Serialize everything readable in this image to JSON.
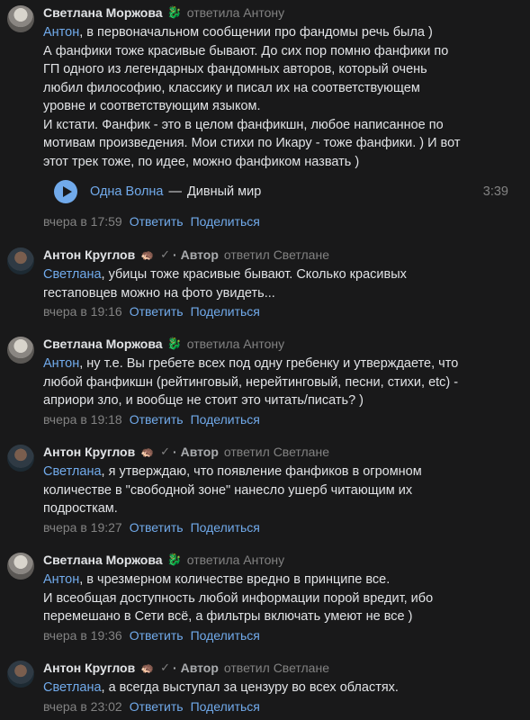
{
  "comments": [
    {
      "author": "Светлана Моржова",
      "badge_icon": "dragon-emoji-icon",
      "replied": "ответила Антону",
      "mention": "Антон",
      "lines": [
        ", в первоначальном сообщении про фандомы речь была )",
        "А фанфики тоже красивые бывают. До сих пор помню фанфики по",
        "ГП одного из легендарных фандомных авторов, который очень",
        "любил философию, классику и писал их на соответствующем",
        "уровне и соответствующим языком.",
        "И кстати. Фанфик - это в целом фанфикшн, любое написанное по",
        "мотивам произведения. Мои стихи по Икару - тоже фанфики. ) И вот",
        "этот трек тоже, по идее, можно фанфиком назвать )"
      ],
      "audio": {
        "artist": "Одна Волна",
        "dash": "—",
        "title": "Дивный мир",
        "duration": "3:39"
      },
      "date": "вчера в 17:59",
      "reply": "Ответить",
      "share": "Поделиться"
    },
    {
      "author": "Антон Круглов",
      "badge_icon": "hedgehog-emoji-icon",
      "role": "· Автор",
      "replied": "ответил Светлане",
      "mention": "Светлана",
      "lines": [
        ", убицы тоже красивые бывают. Сколько красивых",
        "гестаповцев можно на фото увидеть..."
      ],
      "date": "вчера в 19:16",
      "reply": "Ответить",
      "share": "Поделиться"
    },
    {
      "author": "Светлана Моржова",
      "badge_icon": "dragon-emoji-icon",
      "replied": "ответила Антону",
      "mention": "Антон",
      "lines": [
        ", ну т.е. Вы гребете всех под одну гребенку и утверждаете, что",
        "любой фанфикшн (рейтинговый, нерейтинговый, песни, стихи, etc) -",
        "априори зло, и вообще не стоит это читать/писать? )"
      ],
      "date": "вчера в 19:18",
      "reply": "Ответить",
      "share": "Поделиться"
    },
    {
      "author": "Антон Круглов",
      "badge_icon": "hedgehog-emoji-icon",
      "role": "· Автор",
      "replied": "ответил Светлане",
      "mention": "Светлана",
      "lines": [
        ", я утверждаю, что появление фанфиков в огромном",
        "количестве в \"свободной зоне\" нанесло ушерб читающим их",
        "подросткам."
      ],
      "date": "вчера в 19:27",
      "reply": "Ответить",
      "share": "Поделиться"
    },
    {
      "author": "Светлана Моржова",
      "badge_icon": "dragon-emoji-icon",
      "replied": "ответила Антону",
      "mention": "Антон",
      "lines": [
        ", в чрезмерном количестве вредно в принципе все.",
        "И всеобщая доступность любой информации порой вредит, ибо",
        "перемешано в Сети всё, а фильтры включать умеют не все )"
      ],
      "date": "вчера в 19:36",
      "reply": "Ответить",
      "share": "Поделиться"
    },
    {
      "author": "Антон Круглов",
      "badge_icon": "hedgehog-emoji-icon",
      "role": "· Автор",
      "replied": "ответил Светлане",
      "mention": "Светлана",
      "lines": [
        ", а всегда выступал за цензуру во всех областях."
      ],
      "date": "вчера в 23:02",
      "reply": "Ответить",
      "share": "Поделиться"
    }
  ]
}
